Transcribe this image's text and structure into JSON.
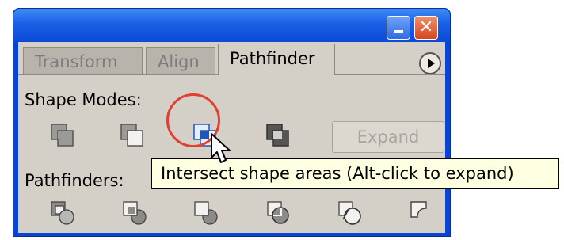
{
  "panel": {
    "tabs": [
      "Transform",
      "Align",
      "Pathfinder"
    ],
    "active_tab": "Pathfinder"
  },
  "shape_modes": {
    "label": "Shape Modes:",
    "buttons": [
      {
        "name": "add-to-shape-area"
      },
      {
        "name": "subtract-from-shape-area"
      },
      {
        "name": "intersect-shape-areas"
      },
      {
        "name": "exclude-overlapping-shape-areas"
      }
    ],
    "expand_label": "Expand"
  },
  "pathfinders": {
    "label": "Pathfinders:",
    "buttons": [
      {
        "name": "divide"
      },
      {
        "name": "trim"
      },
      {
        "name": "merge"
      },
      {
        "name": "crop"
      },
      {
        "name": "outline"
      },
      {
        "name": "minus-back"
      }
    ]
  },
  "tooltip": {
    "text": "Intersect shape areas (Alt-click to expand)"
  },
  "colors": {
    "title_bar": "#0a44d2",
    "panel_bg": "#d4d0c8",
    "highlight_ring": "#e0402f",
    "tooltip_bg": "#ffffe1"
  }
}
